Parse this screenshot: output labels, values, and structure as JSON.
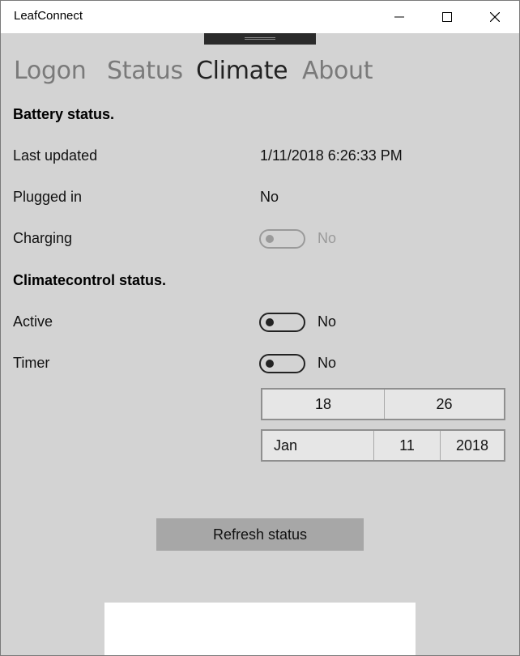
{
  "window": {
    "title": "LeafConnect",
    "controls": {
      "minimize_icon": "minimize-icon",
      "maximize_icon": "maximize-icon",
      "close_icon": "close-icon"
    }
  },
  "pivot": {
    "tabs": [
      {
        "label": "Logon",
        "active": false
      },
      {
        "label": "Status",
        "active": false
      },
      {
        "label": "Climate",
        "active": true
      },
      {
        "label": "About",
        "active": false
      }
    ]
  },
  "battery": {
    "heading": "Battery status.",
    "last_updated_label": "Last updated",
    "last_updated_value": "1/11/2018 6:26:33 PM",
    "plugged_in_label": "Plugged in",
    "plugged_in_value": "No",
    "charging_label": "Charging",
    "charging_toggle_text": "No",
    "charging_on": false,
    "charging_enabled": false
  },
  "climate": {
    "heading": "Climatecontrol status.",
    "active_label": "Active",
    "active_toggle_text": "No",
    "active_on": false,
    "timer_label": "Timer",
    "timer_toggle_text": "No",
    "timer_on": false,
    "time_picker": {
      "hour": "18",
      "minute": "26"
    },
    "date_picker": {
      "month": "Jan",
      "day": "11",
      "year": "2018"
    }
  },
  "actions": {
    "refresh_label": "Refresh status"
  },
  "colors": {
    "content_bg": "#d3d3d3",
    "button_bg": "#a7a7a7",
    "active_tab": "#222222",
    "inactive_tab": "#7a7a7a",
    "disabled": "#9a9a9a"
  }
}
